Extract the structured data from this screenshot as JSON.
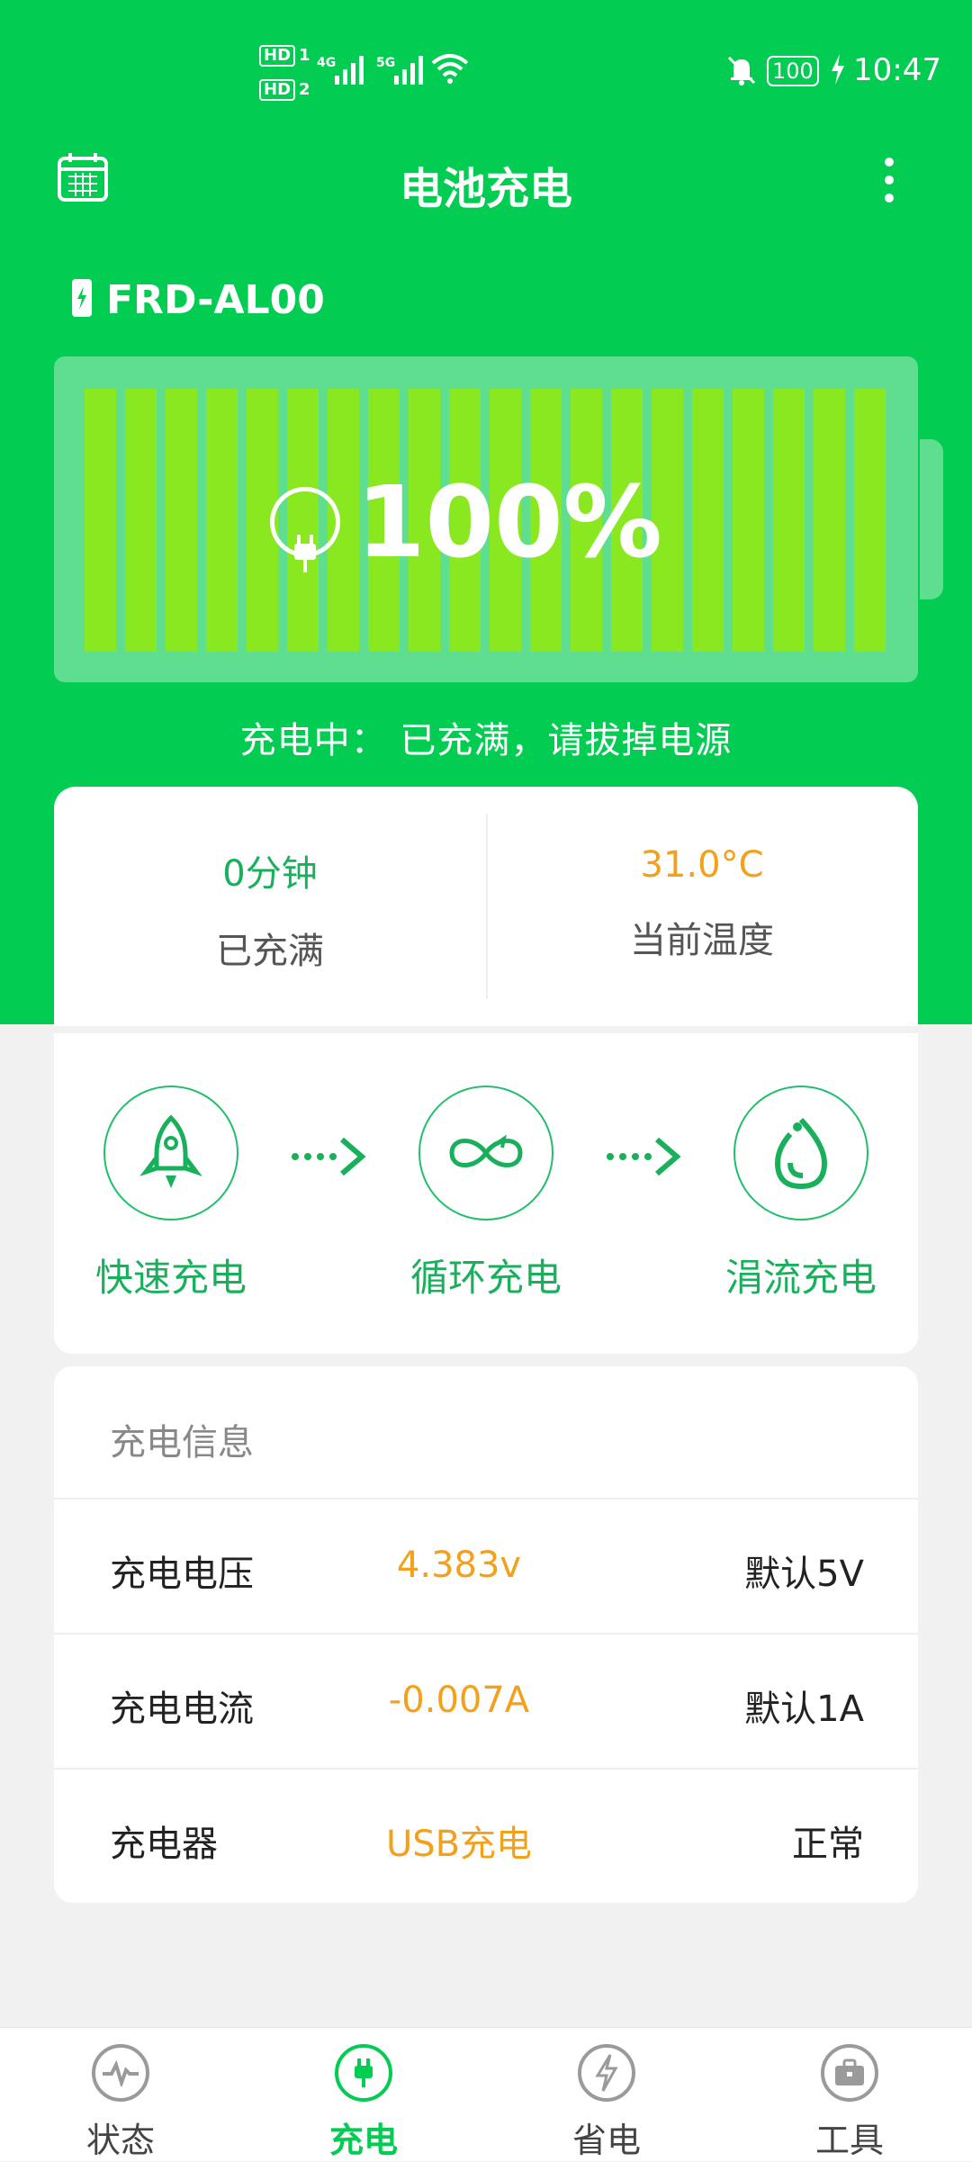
{
  "status_bar": {
    "hd1": "HD",
    "hd1_num": "1",
    "hd2": "HD",
    "hd2_num": "2",
    "net1": "4G",
    "net2": "5G",
    "battery_level": "100",
    "time": "10:47"
  },
  "header": {
    "title": "电池充电"
  },
  "device": {
    "name": "FRD-AL00"
  },
  "battery": {
    "percent_text": "100%",
    "level": 1.0
  },
  "charging_status": "充电中： 已充满，请拔掉电源",
  "stats": [
    {
      "value": "0分钟",
      "label": "已充满",
      "color": "#19b05c"
    },
    {
      "value": "31.0°C",
      "label": "当前温度",
      "color": "#f3a01b"
    }
  ],
  "modes": [
    {
      "label": "快速充电",
      "icon": "rocket-icon"
    },
    {
      "label": "循环充电",
      "icon": "infinity-icon"
    },
    {
      "label": "涓流充电",
      "icon": "drop-icon"
    }
  ],
  "info": {
    "title": "充电信息",
    "rows": [
      {
        "name": "充电电压",
        "value": "4.383v",
        "note": "默认5V"
      },
      {
        "name": "充电电流",
        "value": "-0.007A",
        "note": "默认1A"
      },
      {
        "name": "充电器",
        "value": "USB充电",
        "note": "正常"
      }
    ]
  },
  "nav": [
    {
      "label": "状态",
      "icon": "pulse-icon",
      "active": false
    },
    {
      "label": "充电",
      "icon": "plug-icon",
      "active": true
    },
    {
      "label": "省电",
      "icon": "bolt-icon",
      "active": false
    },
    {
      "label": "工具",
      "icon": "toolbox-icon",
      "active": false
    }
  ],
  "colors": {
    "primary_green": "#03cc53",
    "accent_orange": "#f3a01b",
    "cell_green": "#8ae820"
  }
}
